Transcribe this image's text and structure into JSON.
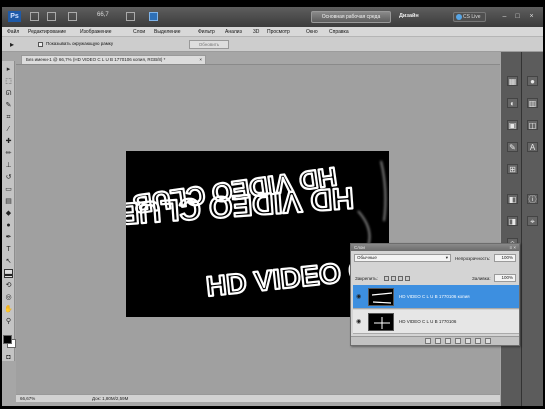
{
  "appbar": {
    "logo": "Ps",
    "zoom": "66,7",
    "workspace": "Основная рабочая среда",
    "design": "Дизайн",
    "live": "CS Live"
  },
  "menu": [
    "Файл",
    "Редактирование",
    "Изображение",
    "Слои",
    "Выделение",
    "Фильтр",
    "Анализ",
    "3D",
    "Просмотр",
    "Окно",
    "Справка"
  ],
  "options": {
    "checkbox_label": "Показывать окружающую рамку",
    "align_button": "Обновить"
  },
  "document": {
    "tab_title": "Без имени-1 @ 66,7% (HD VIDEO C L U B 1770106 копия, RGB/8) *",
    "zoom_status": "66,67%",
    "doc_size": "Док: 1,80M/2,59M"
  },
  "canvas_text": "HD VIDEO CLUB",
  "layers": {
    "title": "Слои",
    "blend_mode": "Обычные",
    "opacity_label": "Непрозрачность:",
    "opacity_value": "100%",
    "lock_label": "Закрепить:",
    "fill_label": "Заливка:",
    "fill_value": "100%",
    "items": [
      {
        "name": "HD VIDEO C L U B 1770106 копия",
        "selected": true
      },
      {
        "name": "HD VIDEO C L U B 1770106",
        "selected": false
      }
    ]
  }
}
